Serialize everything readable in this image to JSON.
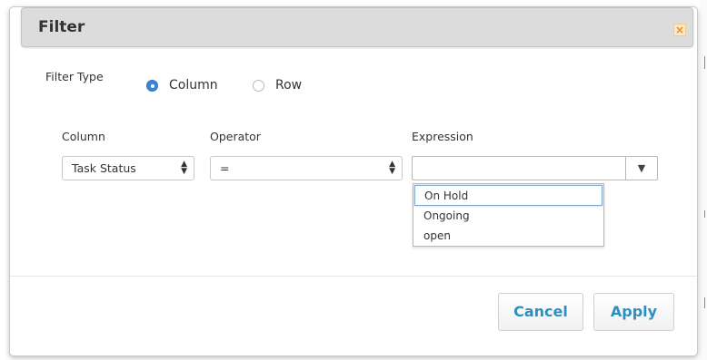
{
  "dialog": {
    "title": "Filter",
    "close_icon": "close-icon"
  },
  "filter_type": {
    "label": "Filter Type",
    "options": [
      {
        "label": "Column",
        "checked": true
      },
      {
        "label": "Row",
        "checked": false
      }
    ]
  },
  "fields": {
    "column": {
      "label": "Column",
      "value": "Task Status"
    },
    "operator": {
      "label": "Operator",
      "value": "="
    },
    "expression": {
      "label": "Expression",
      "value": ""
    }
  },
  "expression_dropdown": {
    "options": [
      "On Hold",
      "Ongoing",
      "open"
    ],
    "highlighted_index": 0
  },
  "buttons": {
    "cancel": "Cancel",
    "apply": "Apply"
  },
  "colors": {
    "accent": "#2d8fbf",
    "radio_checked": "#3a86d4",
    "close_orange": "#f28a1c"
  }
}
